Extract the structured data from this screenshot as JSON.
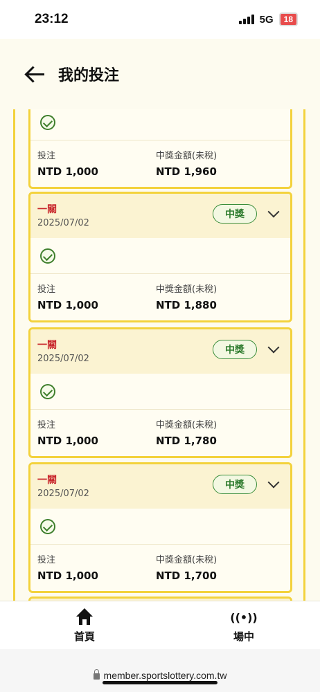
{
  "status_bar": {
    "time": "23:12",
    "network": "5G",
    "battery": "18"
  },
  "header": {
    "title": "我的投注"
  },
  "labels": {
    "stake": "投注",
    "payout": "中獎金額(未稅)"
  },
  "partial_card": {
    "stake": "NTD 1,000",
    "payout": "NTD 1,960"
  },
  "cards": [
    {
      "type": "一關",
      "date": "2025/07/02",
      "status": "中獎",
      "stake": "NTD 1,000",
      "payout": "NTD 1,880"
    },
    {
      "type": "一關",
      "date": "2025/07/02",
      "status": "中獎",
      "stake": "NTD 1,000",
      "payout": "NTD 1,780"
    },
    {
      "type": "一關",
      "date": "2025/07/02",
      "status": "中獎",
      "stake": "NTD 1,000",
      "payout": "NTD 1,700"
    }
  ],
  "bottom_nav": {
    "home_label": "首頁",
    "live_label": "場中"
  },
  "browser": {
    "url": "member.sportslottery.com.tw"
  },
  "colors": {
    "accent_yellow": "#f3d23c",
    "win_green": "#2f7c2f",
    "type_red": "#c8262b"
  }
}
